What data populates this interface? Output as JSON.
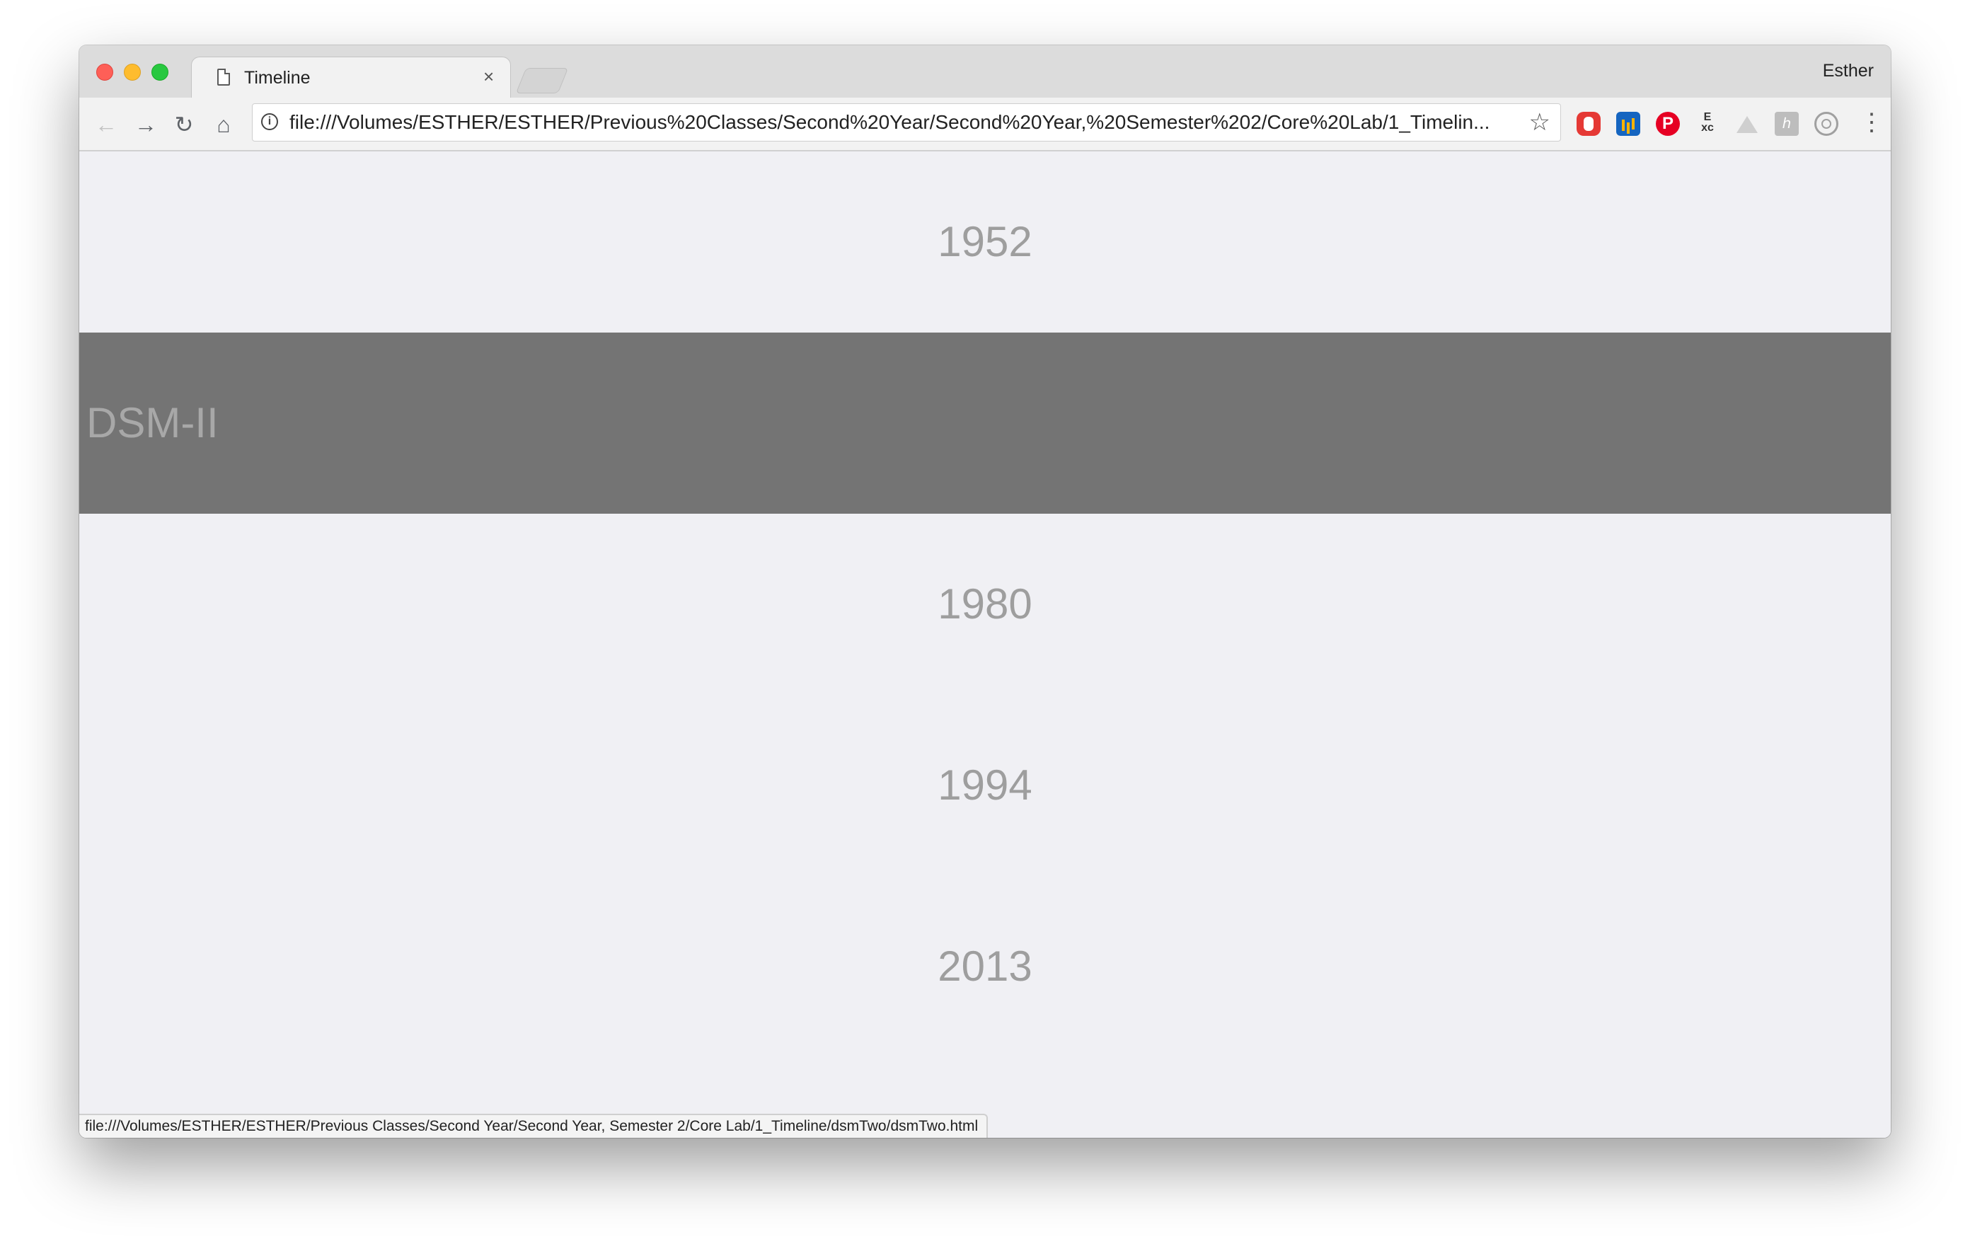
{
  "browser": {
    "tab_title": "Timeline",
    "tab_close": "×",
    "profile_name": "Esther",
    "url": "file:///Volumes/ESTHER/ESTHER/Previous%20Classes/Second%20Year/Second%20Year,%20Semester%202/Core%20Lab/1_Timelin...",
    "status_url": "file:///Volumes/ESTHER/ESTHER/Previous Classes/Second Year/Second Year, Semester 2/Core Lab/1_Timeline/dsmTwo/dsmTwo.html",
    "icons": {
      "back": "←",
      "forward": "→",
      "reload": "↻",
      "home": "⌂",
      "info": "i",
      "star": "☆",
      "menu": "⋮",
      "pinterest": "P",
      "exc": "E\nxc",
      "bookmark": "ℎ"
    }
  },
  "timeline": {
    "rows": [
      {
        "year": "1952"
      },
      {
        "label": "DSM-II"
      },
      {
        "year": "1980"
      },
      {
        "year": "1994"
      },
      {
        "year": "2013"
      }
    ]
  }
}
